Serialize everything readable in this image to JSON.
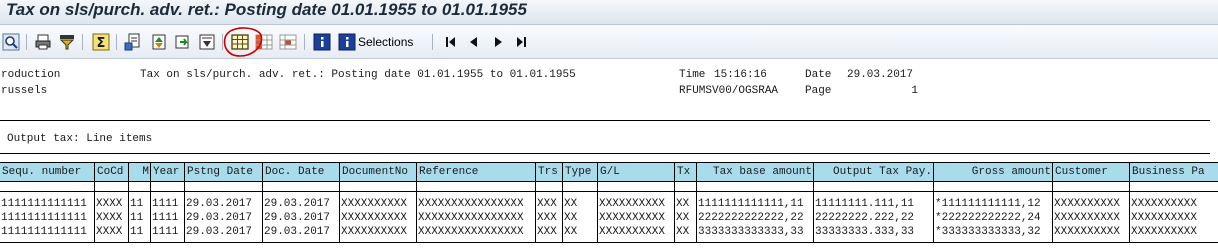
{
  "window": {
    "title": "Tax on sls/purch. adv. ret.: Posting date 01.01.1955 to 01.01.1955"
  },
  "toolbar": {
    "selections_label": "Selections",
    "icons": [
      "find-icon",
      "print-icon",
      "filter-icon",
      "sum-icon",
      "export-icon",
      "sort-icon",
      "refresh-icon",
      "layout-icon",
      "grid-icon",
      "columns-icon",
      "details-icon",
      "info-icon",
      "selections-icon",
      "first-page-icon",
      "prev-page-icon",
      "next-page-icon",
      "last-page-icon"
    ],
    "accent": "#cc0000"
  },
  "report_header": {
    "company_line1": "roduction",
    "company_line2": "russels",
    "title": "Tax on sls/purch. adv. ret.: Posting date 01.01.1955 to 01.01.1955",
    "time_label": "Time",
    "time": "15:16:16",
    "date_label": "Date",
    "date": "29.03.2017",
    "program": "RFUMSV00/OGSRAA",
    "page_label": "Page",
    "page": "1"
  },
  "section": {
    "title": "Output tax: Line items"
  },
  "table": {
    "header_color": "#a8dcea",
    "columns": [
      "Sequ. number",
      "CoCd",
      "M",
      "Year",
      "Pstng Date",
      "Doc. Date",
      "DocumentNo",
      "Reference",
      "Trs",
      "Type",
      "G/L",
      "Tx",
      "Tax base amount",
      "Output Tax Pay.",
      "Gross amount",
      "Customer",
      "Business Pa"
    ],
    "rows": [
      [
        "1111111111111",
        "XXXX",
        "11",
        "1111",
        "29.03.2017",
        "29.03.2017",
        "XXXXXXXXXX",
        "XXXXXXXXXXXXXXXX",
        "XXX",
        "XX",
        "XXXXXXXXXX",
        "XX",
        "1111111111111,11",
        "11111111.111,11",
        "*111111111111,12",
        "XXXXXXXXXX",
        "XXXXXXXXXX"
      ],
      [
        "1111111111111",
        "XXXX",
        "11",
        "1111",
        "29.03.2017",
        "29.03.2017",
        "XXXXXXXXXX",
        "XXXXXXXXXXXXXXXX",
        "XXX",
        "XX",
        "XXXXXXXXXX",
        "XX",
        "2222222222222,22",
        "22222222.222,22",
        "*222222222222,24",
        "XXXXXXXXXX",
        "XXXXXXXXXX"
      ],
      [
        "1111111111111",
        "XXXX",
        "11",
        "1111",
        "29.03.2017",
        "29.03.2017",
        "XXXXXXXXXX",
        "XXXXXXXXXXXXXXXX",
        "XXX",
        "XX",
        "XXXXXXXXXX",
        "XX",
        "3333333333333,33",
        "33333333.333,33",
        "*333333333333,32",
        "XXXXXXXXXX",
        "XXXXXXXXXX"
      ]
    ]
  }
}
